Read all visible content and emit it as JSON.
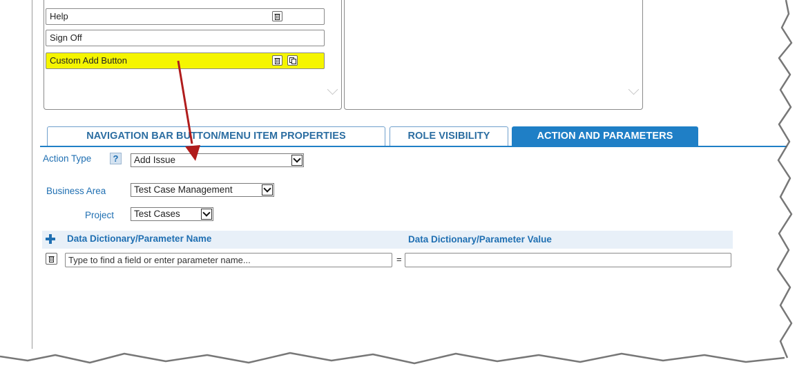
{
  "nav_items": [
    {
      "label": "Help",
      "has_delete": true,
      "has_copy": false,
      "selected": false
    },
    {
      "label": "Sign Off",
      "has_delete": false,
      "has_copy": false,
      "selected": false
    },
    {
      "label": "Custom Add Button",
      "has_delete": true,
      "has_copy": true,
      "selected": true
    }
  ],
  "tabs": [
    {
      "label": "NAVIGATION BAR BUTTON/MENU ITEM PROPERTIES",
      "active": false
    },
    {
      "label": "ROLE VISIBILITY",
      "active": false
    },
    {
      "label": "ACTION AND PARAMETERS",
      "active": true
    }
  ],
  "form": {
    "action_type_label": "Action Type",
    "action_type_help": "?",
    "action_type_value": "Add Issue",
    "business_area_label": "Business Area",
    "business_area_value": "Test Case Management",
    "project_label": "Project",
    "project_value": "Test Cases"
  },
  "params": {
    "name_header": "Data Dictionary/Parameter Name",
    "value_header": "Data Dictionary/Parameter Value",
    "name_placeholder": "Type to find a field or enter parameter name...",
    "equals": "=",
    "value_value": ""
  },
  "icons": {
    "add": "plus-icon",
    "delete": "trash-icon",
    "copy": "copy-icon",
    "dropdown": "chevron-down-icon"
  },
  "colors": {
    "accent": "#1f7fc6",
    "selected_row": "#f5f500",
    "annotation_arrow": "#b01c1c"
  }
}
